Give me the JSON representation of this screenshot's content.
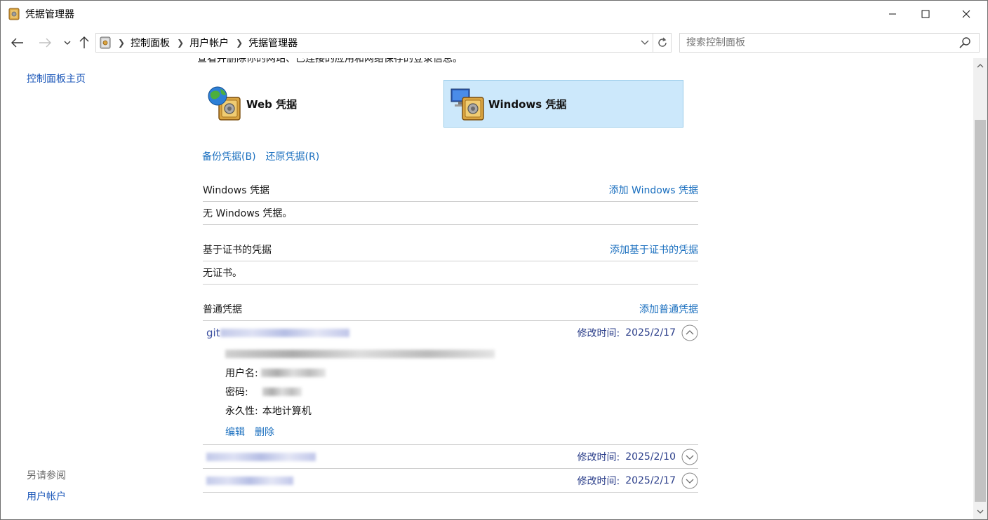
{
  "window": {
    "title": "凭据管理器",
    "controls": {
      "minimize": "minimize-icon",
      "maximize": "maximize-icon",
      "close": "close-icon"
    }
  },
  "address": {
    "crumbs": [
      "控制面板",
      "用户帐户",
      "凭据管理器"
    ]
  },
  "search": {
    "placeholder": "搜索控制面板"
  },
  "left": {
    "home": "控制面板主页",
    "see_also": "另请参阅",
    "user_accounts": "用户帐户"
  },
  "content": {
    "intro_partial": "查看并删除你的网站、已连接的应用和网络保存的登录信息。",
    "web_credentials": "Web 凭据",
    "windows_credentials": "Windows 凭据",
    "backup": "备份凭据(B)",
    "restore": "还原凭据(R)"
  },
  "sections": {
    "windows": {
      "title": "Windows 凭据",
      "add": "添加 Windows 凭据",
      "empty": "无 Windows 凭据。"
    },
    "cert": {
      "title": "基于证书的凭据",
      "add": "添加基于证书的凭据",
      "empty": "无证书。"
    },
    "generic": {
      "title": "普通凭据",
      "add": "添加普通凭据",
      "mod_label": "修改时间:",
      "items": [
        {
          "name_prefix": "git",
          "date": "2025/2/17",
          "expanded": true,
          "username_label": "用户名:",
          "password_label": "密码:",
          "persistence_label": "永久性:",
          "persistence_value": "本地计算机",
          "edit": "编辑",
          "delete": "删除"
        },
        {
          "date": "2025/2/10",
          "expanded": false
        },
        {
          "date": "2025/2/17",
          "expanded": false
        }
      ]
    }
  },
  "colors": {
    "link": "#1a6fbf",
    "selected_bg": "#cce8fb",
    "selected_border": "#99cce9",
    "meta_text": "#2b3e8a"
  }
}
